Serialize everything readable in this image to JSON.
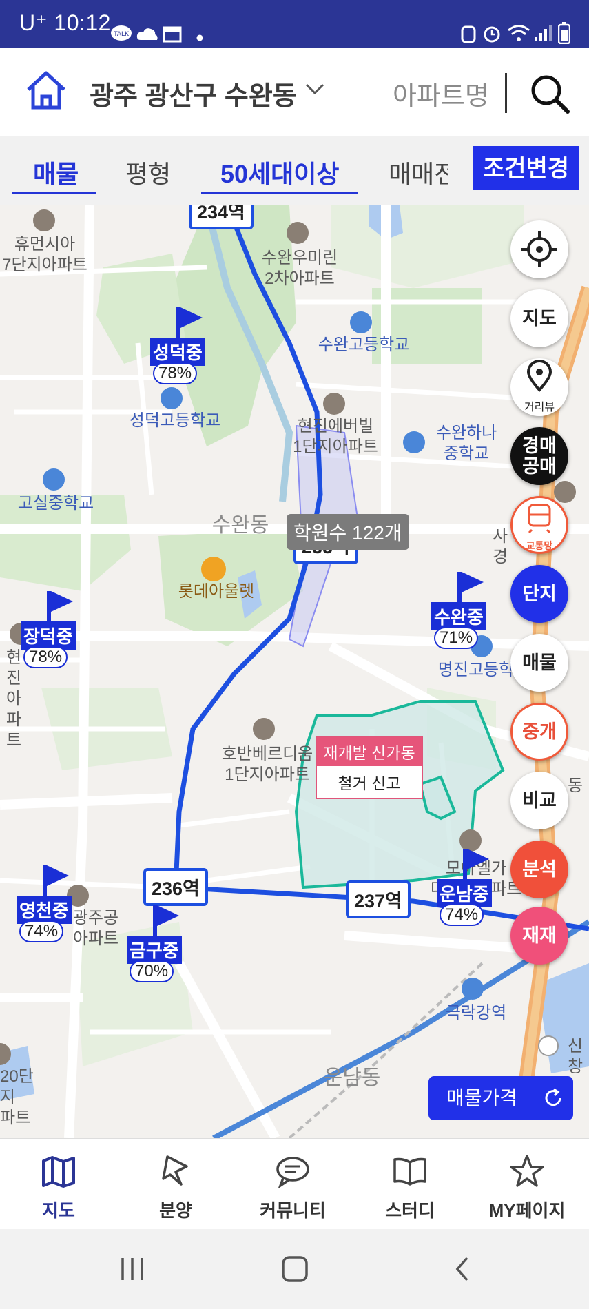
{
  "status_bar": {
    "carrier": "U⁺",
    "time": "10:12",
    "talk_badge": "TALK"
  },
  "header": {
    "region": "광주 광산구 수완동",
    "apartment_search_placeholder": "아파트명"
  },
  "filters": {
    "tabs": [
      {
        "label": "매물",
        "active": true
      },
      {
        "label": "평형",
        "active": false
      },
      {
        "label": "50세대이상",
        "active": true
      },
      {
        "label": "매매전",
        "active": false
      }
    ],
    "change_conditions": "조건변경"
  },
  "map": {
    "places": [
      {
        "id": "humensia",
        "text": "휴먼시아\n7단지아파트"
      },
      {
        "id": "suwan-umirin",
        "text": "수완우미린\n2차아파트"
      },
      {
        "id": "suwan-high",
        "text": "수완고등학교"
      },
      {
        "id": "seongdeok-high",
        "text": "성덕고등학교"
      },
      {
        "id": "hyeonjin",
        "text": "현진에버빌\n1단지아파트"
      },
      {
        "id": "suwan-hana",
        "text": "수완하나\n중학교"
      },
      {
        "id": "gosil-middle",
        "text": "고실중학교"
      },
      {
        "id": "suwandong",
        "text": "수완동"
      },
      {
        "id": "lotte-outlet",
        "text": "롯데아울렛"
      },
      {
        "id": "myeongjin-high",
        "text": "명진고등학"
      },
      {
        "id": "hoban",
        "text": "호반베르디움\n1단지아파트"
      },
      {
        "id": "gwangju-apt",
        "text": "광주공\n아파트"
      },
      {
        "id": "modelga",
        "text": "모아엘가\n더운남아파트"
      },
      {
        "id": "geukrak",
        "text": "극락강역"
      },
      {
        "id": "unnamdong",
        "text": "운남동"
      },
      {
        "id": "jangdeok-apt",
        "text": "현진\n아파트"
      },
      {
        "id": "sinchang",
        "text": "신창"
      },
      {
        "id": "sagyeong",
        "text": "사경"
      },
      {
        "id": "dong-partial",
        "text": "동"
      },
      {
        "id": "apt20",
        "text": "20단지\n파트"
      }
    ],
    "stations": [
      {
        "id": "st234",
        "label": "234역"
      },
      {
        "id": "st235",
        "label": "235역"
      },
      {
        "id": "st236",
        "label": "236역"
      },
      {
        "id": "st237",
        "label": "237역"
      }
    ],
    "academy_count": "학원수 122개",
    "redevelopment": {
      "title": "재개발 신가동",
      "subtitle": "철거 신고"
    },
    "schools": [
      {
        "name": "성덕중",
        "pct": "78%"
      },
      {
        "name": "장덕중",
        "pct": "78%"
      },
      {
        "name": "수완중",
        "pct": "71%"
      },
      {
        "name": "영천중",
        "pct": "74%"
      },
      {
        "name": "금구중",
        "pct": "70%"
      },
      {
        "name": "운남중",
        "pct": "74%"
      }
    ],
    "fab": {
      "location": "",
      "map": "지도",
      "street_view": "거리뷰",
      "auction_line1": "경매",
      "auction_line2": "공매",
      "transit": "교통망",
      "complex": "단지",
      "listing": "매물",
      "broker": "중개",
      "compare": "비교",
      "analysis": "분석",
      "rebuild": "재재"
    },
    "price_button": "매물가격"
  },
  "bottom_nav": [
    {
      "label": "지도",
      "icon": "map-icon",
      "active": true
    },
    {
      "label": "분양",
      "icon": "flag-icon",
      "active": false
    },
    {
      "label": "커뮤니티",
      "icon": "chat-icon",
      "active": false
    },
    {
      "label": "스터디",
      "icon": "book-icon",
      "active": false
    },
    {
      "label": "MY페이지",
      "icon": "star-icon",
      "active": false
    }
  ],
  "colors": {
    "brand": "#2130e8",
    "status_bar": "#2b3595",
    "route": "#1d4fe0",
    "accent_red": "#f0503a"
  }
}
